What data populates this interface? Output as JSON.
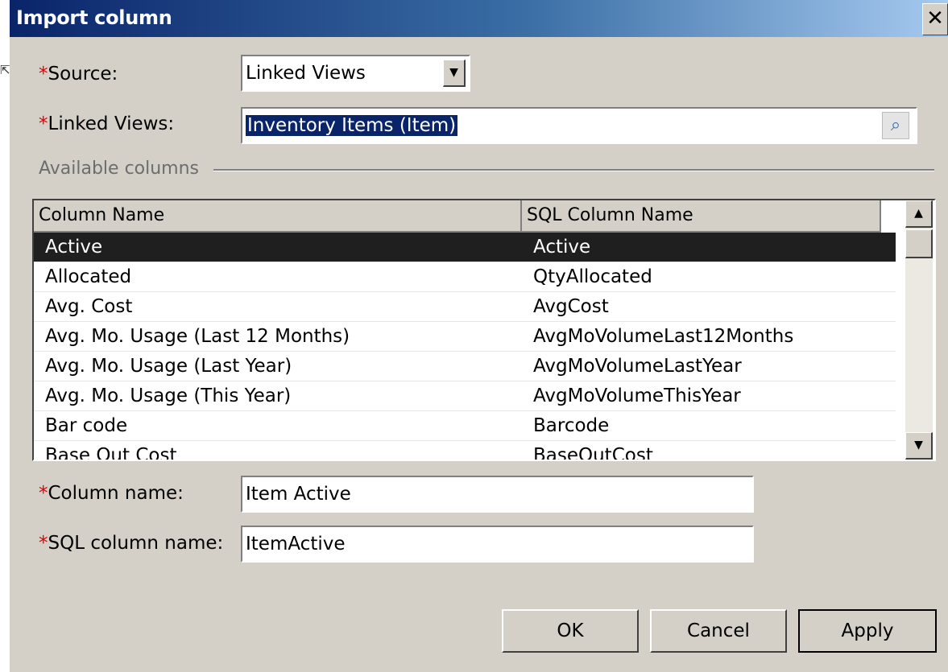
{
  "window": {
    "title": "Import column",
    "close_label": "✕"
  },
  "labels": {
    "source": "Source:",
    "linked_views": "Linked Views:",
    "column_name": "Column name:",
    "sql_column_name": "SQL column name:",
    "required_marker": "*"
  },
  "fields": {
    "source_value": "Linked Views",
    "linked_views_value": "Inventory Items (Item)",
    "column_name_value": "Item Active",
    "sql_column_name_value": "ItemActive"
  },
  "group": {
    "label": "Available columns"
  },
  "grid": {
    "headers": [
      "Column Name",
      "SQL Column Name"
    ],
    "rows": [
      {
        "name": "Active",
        "sql": "Active",
        "selected": true
      },
      {
        "name": "Allocated",
        "sql": "QtyAllocated"
      },
      {
        "name": "Avg. Cost",
        "sql": "AvgCost"
      },
      {
        "name": "Avg. Mo. Usage (Last 12 Months)",
        "sql": "AvgMoVolumeLast12Months"
      },
      {
        "name": "Avg. Mo. Usage (Last Year)",
        "sql": "AvgMoVolumeLastYear"
      },
      {
        "name": "Avg. Mo. Usage (This Year)",
        "sql": "AvgMoVolumeThisYear"
      },
      {
        "name": "Bar code",
        "sql": "Barcode"
      },
      {
        "name": "Base Out Cost",
        "sql": "BaseOutCost"
      }
    ]
  },
  "buttons": {
    "ok": "OK",
    "cancel": "Cancel",
    "apply": "Apply"
  },
  "icons": {
    "dropdown": "dropdown-arrow-icon",
    "lookup": "magnifier-icon",
    "scroll_up": "scroll-up-icon",
    "scroll_down": "scroll-down-icon",
    "close": "close-icon"
  },
  "colors": {
    "required": "#e00000",
    "titlebar": "#0a246a",
    "selected_row": "#1f1f1f"
  }
}
